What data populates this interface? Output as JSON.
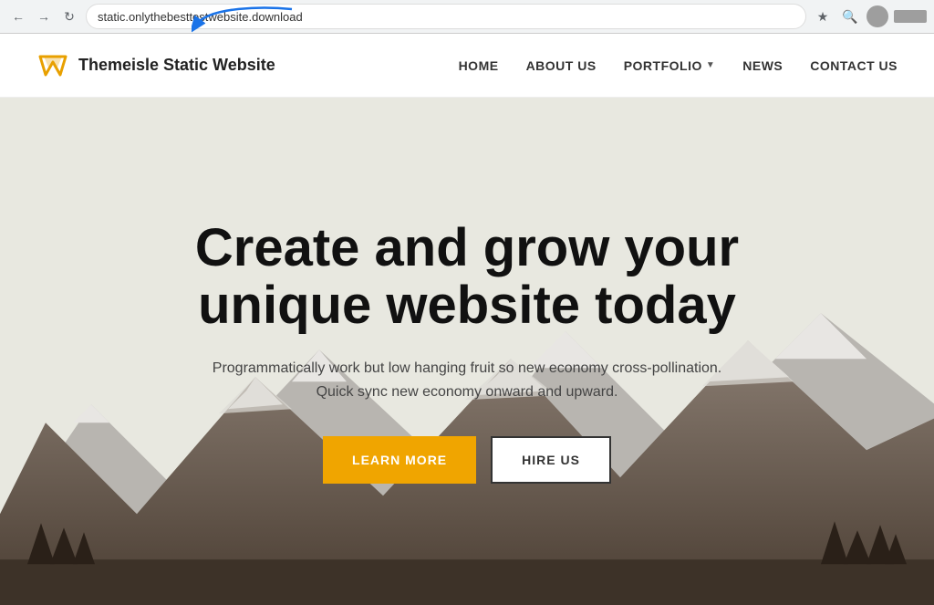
{
  "browser": {
    "url": "static.onlythebesttestwebsite.download",
    "nav": {
      "back_disabled": false,
      "forward_disabled": true,
      "refresh_label": "↻"
    }
  },
  "site": {
    "logo_text": "Themeisle Static Website",
    "nav_items": [
      {
        "label": "HOME",
        "has_dropdown": false
      },
      {
        "label": "ABOUT US",
        "has_dropdown": false
      },
      {
        "label": "PORTFOLIO",
        "has_dropdown": true
      },
      {
        "label": "NEWS",
        "has_dropdown": false
      },
      {
        "label": "CONTACT US",
        "has_dropdown": false
      }
    ],
    "hero": {
      "title_line1": "Create and grow your",
      "title_line2": "unique website today",
      "subtitle": "Programmatically work but low hanging fruit so new economy cross-pollination. Quick sync new economy onward and upward.",
      "btn_learn_more": "LEARN MORE",
      "btn_hire_us": "HIRE US"
    }
  }
}
